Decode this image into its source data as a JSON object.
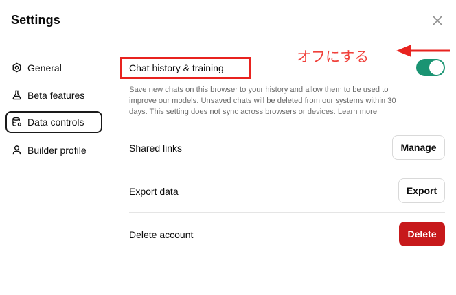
{
  "header": {
    "title": "Settings",
    "close_icon": "close-icon"
  },
  "annotation": {
    "text": "オフにする",
    "color": "#f0413b"
  },
  "sidebar": {
    "items": [
      {
        "label": "General",
        "icon": "gear-icon",
        "active": false
      },
      {
        "label": "Beta features",
        "icon": "flask-icon",
        "active": false
      },
      {
        "label": "Data controls",
        "icon": "database-icon",
        "active": true
      },
      {
        "label": "Builder profile",
        "icon": "user-icon",
        "active": false
      }
    ]
  },
  "data_controls": {
    "chat_history": {
      "label": "Chat history & training",
      "description": "Save new chats on this browser to your history and allow them to be used to improve our models. Unsaved chats will be deleted from our systems within 30 days. This setting does not sync across browsers or devices.",
      "learn_more": "Learn more",
      "toggle_on": true,
      "toggle_color": "#1a9473"
    },
    "shared_links": {
      "label": "Shared links",
      "button": "Manage"
    },
    "export_data": {
      "label": "Export data",
      "button": "Export"
    },
    "delete_account": {
      "label": "Delete account",
      "button": "Delete",
      "button_color": "#c7191b"
    }
  }
}
